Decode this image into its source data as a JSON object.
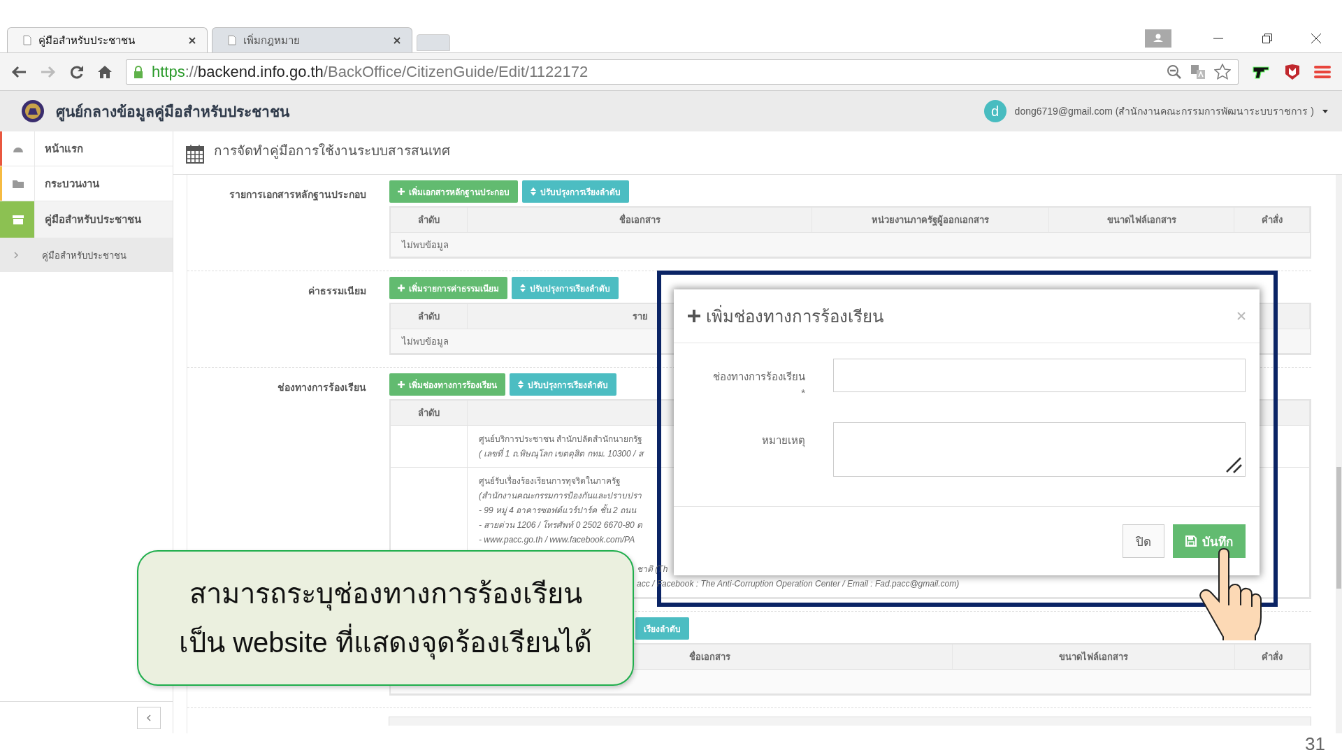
{
  "browser": {
    "tabs": [
      {
        "title": "คู่มือสำหรับประชาชน",
        "selected": true
      },
      {
        "title": "เพิ่มกฎหมาย",
        "selected": false
      }
    ],
    "url": {
      "scheme": "https",
      "separator": "://",
      "host": "backend.info.go.th",
      "path": "/BackOffice/CitizenGuide/Edit/1122172"
    }
  },
  "app": {
    "title": "ศูนย์กลางข้อมูลคู่มือสำหรับประชาชน",
    "avatar": "d",
    "user": "dong6719@gmail.com (สำนักงานคณะกรรมการพัฒนาระบบราชการ )"
  },
  "sidebar": {
    "items": [
      {
        "label": "หน้าแรก",
        "selected": false,
        "color": "#e9573f"
      },
      {
        "label": "กระบวนงาน",
        "selected": false,
        "color": "#f6bb42"
      },
      {
        "label": "คู่มือสำหรับประชาชน",
        "selected": true,
        "color": "#8cc152",
        "expanded": true,
        "children": [
          {
            "label": "คู่มือสำหรับประชาชน",
            "selected": false
          }
        ]
      }
    ]
  },
  "page_title": "การจัดทำคู่มือการใช้งานระบบสารสนเทศ",
  "sections": [
    {
      "label": "รายการเอกสารหลักฐานประกอบ",
      "buttons": [
        {
          "label": "เพิ่มเอกสารหลักฐานประกอบ",
          "kind": "add"
        },
        {
          "label": "ปรับปรุงการเรียงลำดับ",
          "kind": "sort"
        }
      ],
      "columns": [
        "ลำดับ",
        "ชื่อเอกสาร",
        "หน่วยงานภาครัฐผู้ออกเอกสาร",
        "ขนาดไฟล์เอกสาร",
        "คำสั่ง"
      ],
      "rows": [
        {
          "kind": "empty",
          "text": "ไม่พบข้อมูล"
        }
      ]
    },
    {
      "label": "ค่าธรรมเนียม",
      "buttons": [
        {
          "label": "เพิ่มรายการค่าธรรมเนียม",
          "kind": "add"
        },
        {
          "label": "ปรับปรุงการเรียงลำดับ",
          "kind": "sort"
        }
      ],
      "columns": [
        "ลำดับ",
        "ราย"
      ],
      "rows": [
        {
          "kind": "empty",
          "text": "ไม่พบข้อมูล"
        }
      ]
    },
    {
      "label": "ช่องทางการร้องเรียน",
      "buttons": [
        {
          "label": "เพิ่มช่องทางการร้องเรียน",
          "kind": "add"
        },
        {
          "label": "ปรับปรุงการเรียงลำดับ",
          "kind": "sort"
        }
      ],
      "columns": [
        "ลำดับ"
      ],
      "rows": [
        {
          "kind": "entry",
          "lines": [
            {
              "text": "ศูนย์บริการประชาชน สำนักปลัดสำนักนายกรัฐ",
              "kind": "plain"
            },
            {
              "text": "( เลขที่ 1 ถ.พิษณุโลก เขตดุสิต กทม. 10300 / ส",
              "kind": "italic"
            }
          ]
        },
        {
          "kind": "entry",
          "lines": [
            {
              "text": "ศูนย์รับเรื่องร้องเรียนการทุจริตในภาครัฐ",
              "kind": "plain"
            },
            {
              "text": "(สำนักงานคณะกรรมการป้องกันและปราบปรา",
              "kind": "italic"
            },
            {
              "text": "- 99 หมู่ 4 อาคารซอฟต์แวร์ปาร์ค ชั้น 2 ถนน",
              "kind": "italic"
            },
            {
              "text": "- สายด่วน 1206 / โทรศัพท์ 0 2502 6670-80 ต",
              "kind": "italic"
            },
            {
              "text": "- www.pacc.go.th / www.facebook.com/PA",
              "kind": "italic"
            },
            {
              "text": "ชาติ (Th",
              "kind": "tail"
            },
            {
              "text": "acc / Facebook : The Anti-Corruption Operation Center / Email : Fad.pacc@gmail.com)",
              "kind": "tail"
            }
          ]
        }
      ]
    },
    {
      "buttons": [
        {
          "label": "เรียงลำดับ",
          "kind": "partial"
        }
      ],
      "columns": [
        "ชื่อเอกสาร",
        "ขนาดไฟล์เอกสาร",
        "คำสั่ง"
      ],
      "rows": [
        {
          "kind": "hidden"
        }
      ]
    }
  ],
  "modal": {
    "title": "เพิ่มช่องทางการร้องเรียน",
    "fields": [
      {
        "label": "ช่องทางการร้องเรียน",
        "required_mark": "*",
        "kind": "text"
      },
      {
        "label": "หมายเหตุ",
        "kind": "textarea"
      }
    ],
    "buttons": [
      {
        "label": "ปิด",
        "kind": "close"
      },
      {
        "label": "บันทึก",
        "kind": "save"
      }
    ]
  },
  "callout": {
    "lines": [
      "สามารถระบุช่องทางการร้องเรียน",
      "เป็น website ที่แสดงจุดร้องเรียนได้"
    ]
  },
  "page_number": "31"
}
